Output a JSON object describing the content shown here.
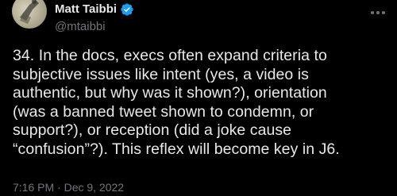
{
  "author": {
    "display_name": "Matt Taibbi",
    "handle": "@mtaibbi",
    "verified": true
  },
  "tweet": {
    "text_lines": [
      "34. In the docs, execs often expand criteria to",
      "subjective issues like intent (yes, a video is",
      "authentic, but why was it shown?), orientation",
      "(was a banned tweet shown to condemn, or",
      "support?), or reception (did a joke cause",
      "“confusion”?). This reflex will become key in J6."
    ],
    "timestamp": "7:16 PM · Dec 9, 2022"
  },
  "icons": {
    "verified": "verified-badge-icon",
    "more": "more-options-icon"
  },
  "colors": {
    "background": "#000000",
    "text_primary": "#e7e9ea",
    "text_secondary": "#71767b",
    "verified_blue": "#1d9bf0"
  }
}
